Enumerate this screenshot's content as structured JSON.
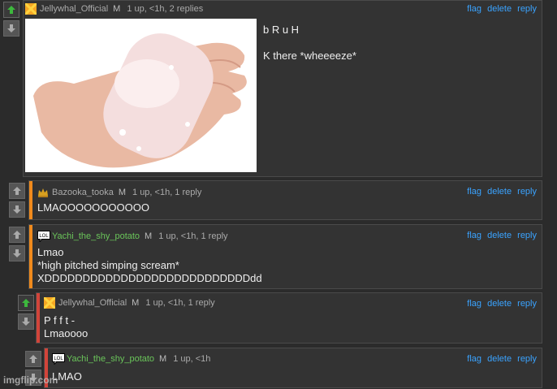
{
  "colors": {
    "accent_link": "#3aa3ff",
    "bar_orange": "#f08a1c",
    "bar_red": "#d2443a",
    "username_green": "#6ac55a",
    "upvote_active": "#3db83d"
  },
  "comments": [
    {
      "user": "Jellywhal_Official",
      "mod": "M",
      "meta": "1 up, <1h, 2 replies",
      "body": "b R u H\n\nK there *wheeeeze*",
      "image_alt": "hand squeezing a bar of soap",
      "actions": {
        "flag": "flag",
        "delete": "delete",
        "reply": "reply"
      }
    },
    {
      "user": "Bazooka_tooka",
      "mod": "M",
      "meta": "1 up, <1h, 1 reply",
      "body": "LMAOOOOOOOOOOO",
      "actions": {
        "flag": "flag",
        "delete": "delete",
        "reply": "reply"
      }
    },
    {
      "user": "Yachi_the_shy_potato",
      "mod": "M",
      "meta": "1 up, <1h, 1 reply",
      "body": "Lmao\n*high pitched simping scream*\nXDDDDDDDDDDDDDDDDDDDDDDDDDDDdd",
      "actions": {
        "flag": "flag",
        "delete": "delete",
        "reply": "reply"
      }
    },
    {
      "user": "Jellywhal_Official",
      "mod": "M",
      "meta": "1 up, <1h, 1 reply",
      "body": "P f f t -\nLmaoooo",
      "actions": {
        "flag": "flag",
        "delete": "delete",
        "reply": "reply"
      }
    },
    {
      "user": "Yachi_the_shy_potato",
      "mod": "M",
      "meta": "1 up, <1h",
      "body": "LMAO",
      "actions": {
        "flag": "flag",
        "delete": "delete",
        "reply": "reply"
      }
    }
  ],
  "watermark": "imgflip.com"
}
